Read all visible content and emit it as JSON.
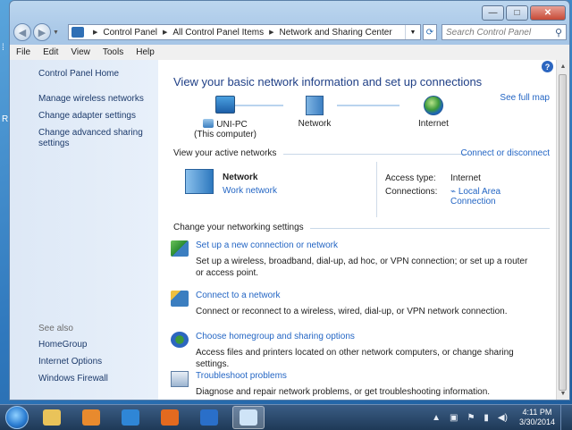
{
  "window": {
    "caption_buttons": {
      "minimize": "—",
      "maximize": "□",
      "close": "✕"
    }
  },
  "navbar": {
    "back_icon": "back-arrow-icon",
    "forward_icon": "forward-arrow-icon",
    "breadcrumbs": [
      "Control Panel",
      "All Control Panel Items",
      "Network and Sharing Center"
    ],
    "search_placeholder": "Search Control Panel"
  },
  "menubar": [
    "File",
    "Edit",
    "View",
    "Tools",
    "Help"
  ],
  "left_pane": {
    "links": [
      "Control Panel Home",
      "Manage wireless networks",
      "Change adapter settings",
      "Change advanced sharing settings"
    ],
    "see_also_title": "See also",
    "see_also": [
      "HomeGroup",
      "Internet Options",
      "Windows Firewall"
    ]
  },
  "main": {
    "heading": "View your basic network information and set up connections",
    "full_map_link": "See full map",
    "map": {
      "computer_name": "UNI-PC",
      "computer_sub": "(This computer)",
      "network_label": "Network",
      "internet_label": "Internet"
    },
    "active_section_title": "View your active networks",
    "connect_disconnect": "Connect or disconnect",
    "active_network": {
      "name": "Network",
      "type": "Work network",
      "access_type_label": "Access type:",
      "access_type_value": "Internet",
      "connections_label": "Connections:",
      "connections_value": "Local Area Connection"
    },
    "settings_section_title": "Change your networking settings",
    "tasks": [
      {
        "title": "Set up a new connection or network",
        "desc": "Set up a wireless, broadband, dial-up, ad hoc, or VPN connection; or set up a router or access point."
      },
      {
        "title": "Connect to a network",
        "desc": "Connect or reconnect to a wireless, wired, dial-up, or VPN network connection."
      },
      {
        "title": "Choose homegroup and sharing options",
        "desc": "Access files and printers located on other network computers, or change sharing settings."
      },
      {
        "title": "Troubleshoot problems",
        "desc": "Diagnose and repair network problems, or get troubleshooting information."
      }
    ]
  },
  "taskbar": {
    "apps": [
      "file-explorer-icon",
      "media-player-icon",
      "internet-explorer-icon",
      "firefox-icon",
      "thunderbird-icon",
      "control-panel-icon"
    ],
    "colors": [
      "#e9c35a",
      "#e88a2e",
      "#2f86d6",
      "#e36a1f",
      "#2a6fc9",
      "#cfe4f7"
    ],
    "clock_time": "4:11 PM",
    "clock_date": "3/30/2014"
  }
}
